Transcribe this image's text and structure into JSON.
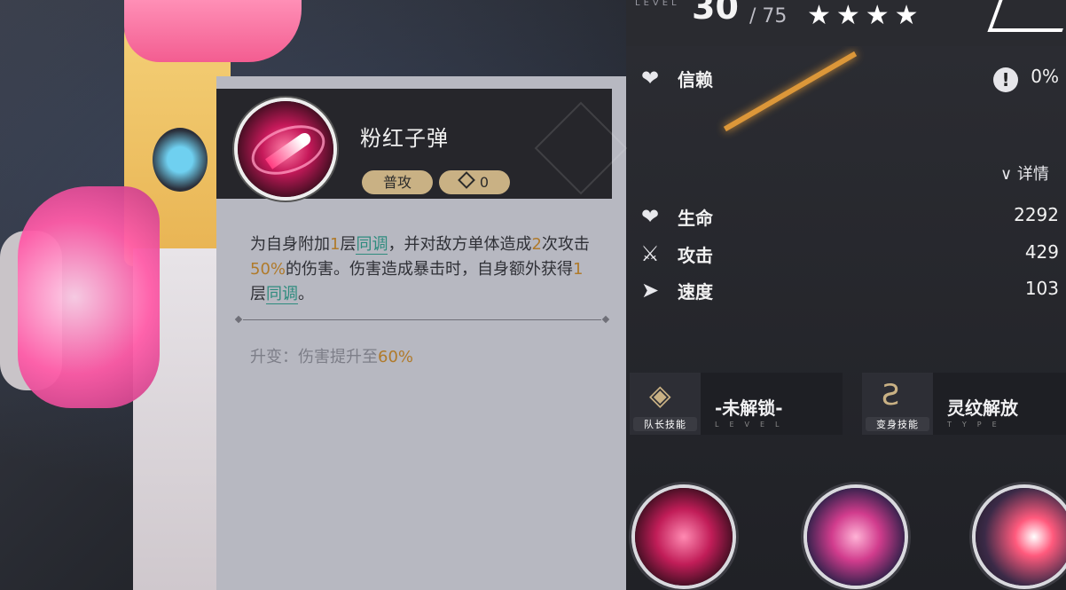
{
  "level": {
    "label": "LEVEL",
    "current": "30",
    "max": "/ 75",
    "stars": "★★★★"
  },
  "trust": {
    "label": "信赖",
    "value": "0%"
  },
  "detail_label": "详情",
  "stats": [
    {
      "icon": "heart-icon",
      "glyph": "❤",
      "label": "生命",
      "value": "2292"
    },
    {
      "icon": "sword-icon",
      "glyph": "⚔",
      "label": "攻击",
      "value": "429"
    },
    {
      "icon": "speed-icon",
      "glyph": "➤",
      "label": "速度",
      "value": "103"
    }
  ],
  "captain_skill": {
    "caption": "队长技能",
    "text": "-未解锁-",
    "sub": "LEVEL"
  },
  "transform_skill": {
    "caption": "变身技能",
    "text": "灵纹解放",
    "sub": "TYPE"
  },
  "skill_card": {
    "name": "粉红子弹",
    "type_tag": "普攻",
    "cost": "0",
    "desc_parts": {
      "p1": "为自身附加",
      "n1": "1",
      "p2": "层",
      "kw1": "同调",
      "p3": "，并对敌方单体造成",
      "n2": "2",
      "p4": "次攻击",
      "n3": "50%",
      "p5": "的伤害。伤害造成暴击时，自身额外获得",
      "n4": "1",
      "p6": "层",
      "kw2": "同调",
      "p7": "。"
    },
    "upgrade_label": "升变：伤害提升至",
    "upgrade_value": "60%"
  }
}
